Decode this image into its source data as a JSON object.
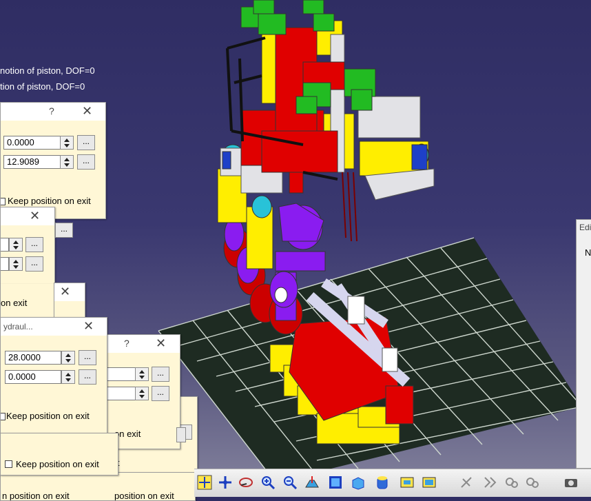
{
  "tree": {
    "line1": "notion of piston, DOF=0",
    "line2": "tion of piston, DOF=0"
  },
  "dialogs": {
    "d1": {
      "q": "?",
      "x": "✕",
      "v1": "0.0000",
      "v2": "12.9089",
      "keep": "Keep position on exit",
      "dots": "..."
    },
    "d2": {
      "x": "✕",
      "dots": "..."
    },
    "d3": {
      "keep": "on exit"
    },
    "d4": {
      "x": "✕"
    },
    "d5": {
      "title": "ydraul...",
      "x": "✕",
      "v1": "28.0000",
      "v2": "0.0000",
      "keep": "Keep position on exit",
      "dots": "..."
    },
    "d6": {
      "q": "?",
      "x": "✕",
      "keep": "on exit",
      "dots": "..."
    },
    "d7": {
      "keep": "Keep position on exit"
    },
    "d8": {
      "keep_r": "it"
    },
    "d9": {
      "keep": "n position on exit",
      "keep_r": "position on exit"
    }
  },
  "edit_panel": {
    "title": "Edi",
    "n_label": "N"
  },
  "colors": {
    "accent_red": "#e00000",
    "accent_yellow": "#ffee00",
    "accent_purple": "#8a1cf0",
    "accent_green": "#22bb22",
    "floor": "#1e2b22"
  },
  "toolbar": {
    "icons": [
      "pan-icon",
      "rotate-icon",
      "fly-icon",
      "zoom-in-icon",
      "zoom-out-icon",
      "normal-view-icon",
      "iso-view-icon",
      "shading-icon",
      "edges-icon",
      "hide-show-icon",
      "swap-icon",
      "sim-icon",
      "next-icon",
      "camera-settings-icon",
      "camera-icon"
    ]
  }
}
